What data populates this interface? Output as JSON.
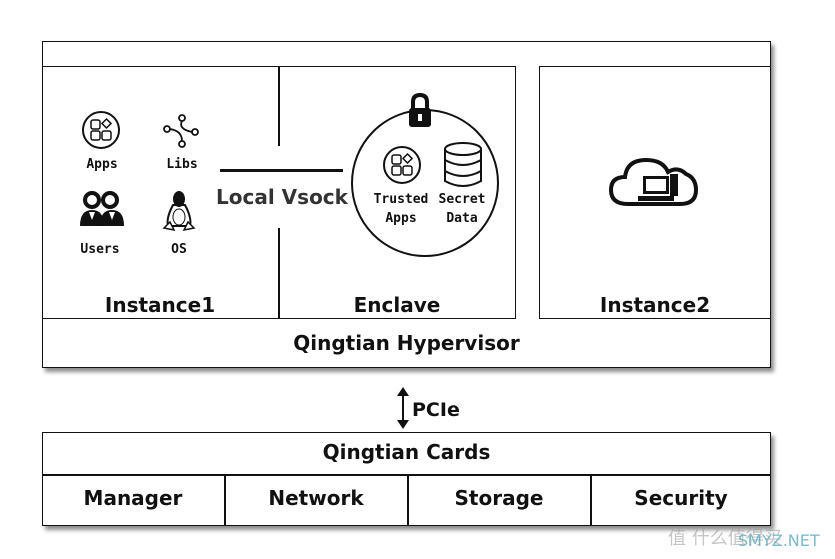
{
  "host": {
    "instance1": {
      "label": "Instance1",
      "items": [
        "Apps",
        "Libs",
        "Users",
        "OS"
      ]
    },
    "vsock_label": "Local Vsock",
    "enclave": {
      "label": "Enclave",
      "items": [
        "Trusted Apps",
        "Secret Data"
      ],
      "trusted_line1": "Trusted",
      "trusted_line2": "Apps",
      "secret_line1": "Secret",
      "secret_line2": "Data"
    },
    "instance2": {
      "label": "Instance2"
    },
    "hypervisor_label": "Qingtian Hypervisor"
  },
  "link_label": "PCIe",
  "cards": {
    "label": "Qingtian Cards",
    "cells": [
      "Manager",
      "Network",
      "Storage",
      "Security"
    ]
  },
  "watermark": {
    "text": "值 什么值得买",
    "site": "SMYZ.NET"
  }
}
